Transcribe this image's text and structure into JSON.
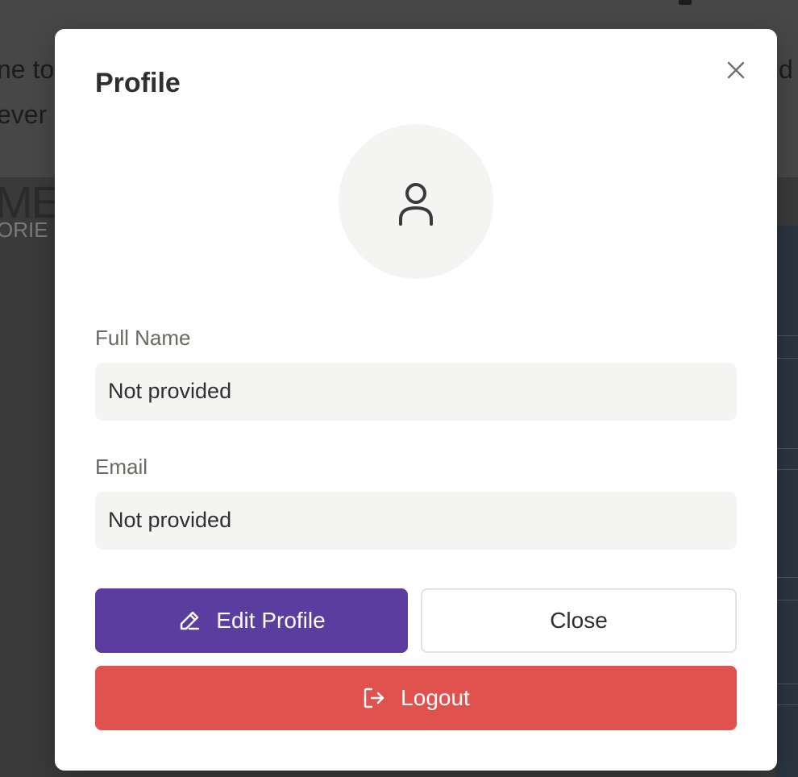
{
  "background": {
    "line1_text": "ne to",
    "line2_text": "ever",
    "right_text": "d",
    "big_text": "ME",
    "small_text": "ORIE"
  },
  "modal": {
    "title": "Profile",
    "close_icon": "close-icon",
    "avatar_icon": "user-icon",
    "fields": [
      {
        "label": "Full Name",
        "value": "Not provided"
      },
      {
        "label": "Email",
        "value": "Not provided"
      }
    ],
    "buttons": {
      "edit_label": "Edit Profile",
      "edit_icon": "pencil-icon",
      "close_label": "Close",
      "logout_label": "Logout",
      "logout_icon": "logout-icon"
    }
  },
  "colors": {
    "primary": "#5a3d9e",
    "danger": "#df524d",
    "field_bg": "#f4f4f2",
    "overlay": "#3f3f3f"
  }
}
